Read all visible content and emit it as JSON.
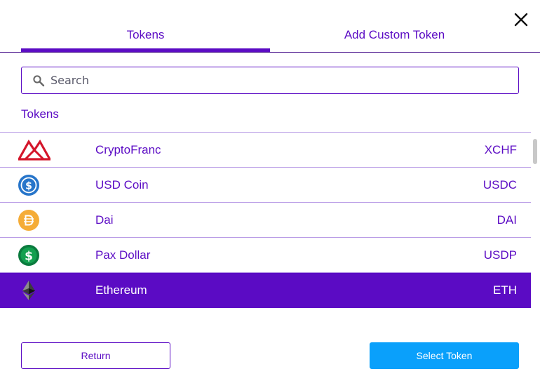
{
  "tabs": [
    {
      "label": "Tokens",
      "active": true
    },
    {
      "label": "Add Custom Token",
      "active": false
    }
  ],
  "search": {
    "placeholder": "Search",
    "value": ""
  },
  "section_title": "Tokens",
  "tokens": [
    {
      "name": "CryptoFranc",
      "symbol": "XCHF",
      "icon": "cryptofranc-logo-icon",
      "selected": false
    },
    {
      "name": "USD Coin",
      "symbol": "USDC",
      "icon": "usdc-logo-icon",
      "selected": false
    },
    {
      "name": "Dai",
      "symbol": "DAI",
      "icon": "dai-logo-icon",
      "selected": false
    },
    {
      "name": "Pax Dollar",
      "symbol": "USDP",
      "icon": "usdp-logo-icon",
      "selected": false
    },
    {
      "name": "Ethereum",
      "symbol": "ETH",
      "icon": "ethereum-logo-icon",
      "selected": true
    }
  ],
  "buttons": {
    "return_label": "Return",
    "select_label": "Select Token"
  },
  "colors": {
    "accent": "#5b0bc4",
    "primary_button": "#0aa0fb",
    "divider": "#b99ce6"
  }
}
